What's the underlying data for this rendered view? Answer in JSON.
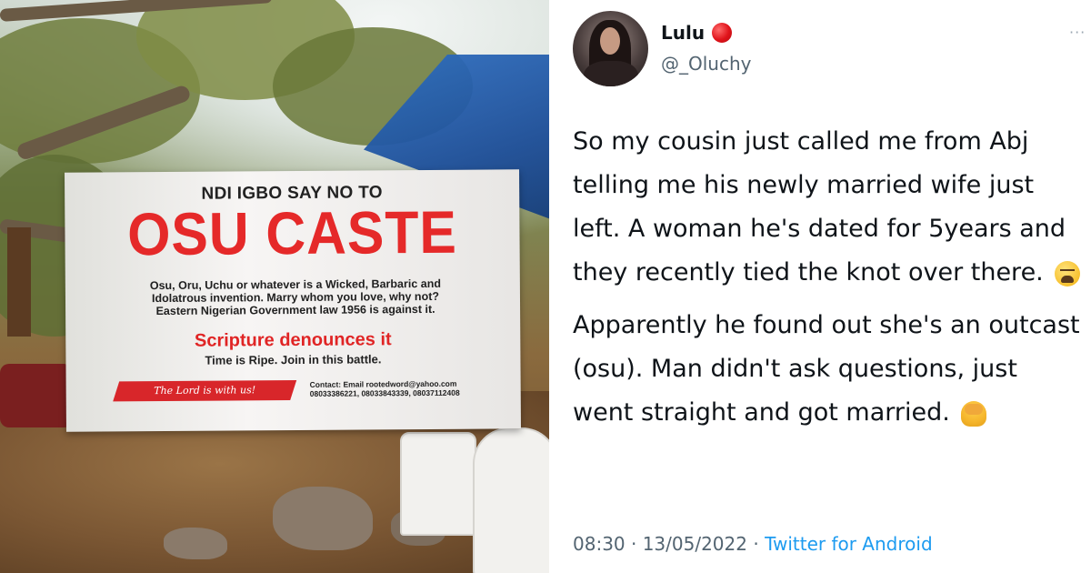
{
  "photo": {
    "banner": {
      "heading": "NDI IGBO SAY NO TO",
      "title": "OSU CASTE",
      "body_lines": [
        "Osu, Oru, Uchu or whatever is a Wicked, Barbaric and",
        "Idolatrous invention. Marry whom you love, why not?",
        "Eastern Nigerian Government law 1956 is against it."
      ],
      "scripture": "Scripture denounces it",
      "time": "Time is Ripe. Join in this battle.",
      "ribbon": "The Lord is with us!",
      "contact_lines": [
        "Contact: Email rootedword@yahoo.com",
        "08033386221, 08033843339, 08037112408"
      ]
    }
  },
  "tweet": {
    "author_name": "Lulu",
    "author_handle": "@_Oluchy",
    "more_label": "···",
    "paragraphs": [
      "So my cousin just called me from Abj telling me his newly married wife just left. A woman he's dated for 5years and they recently tied the knot over there.",
      "Apparently he found out she's an outcast (osu). Man didn't ask questions, just went straight and got married."
    ],
    "emojis": [
      "weary-face-emoji",
      "facepalm-emoji"
    ],
    "timestamp": "08:30 · 13/05/2022 · ",
    "source": "Twitter for Android"
  },
  "colors": {
    "banner_red": "#e52929",
    "name_badge": "#e0131a",
    "link_blue": "#1d9bf0",
    "muted_text": "#536471"
  }
}
